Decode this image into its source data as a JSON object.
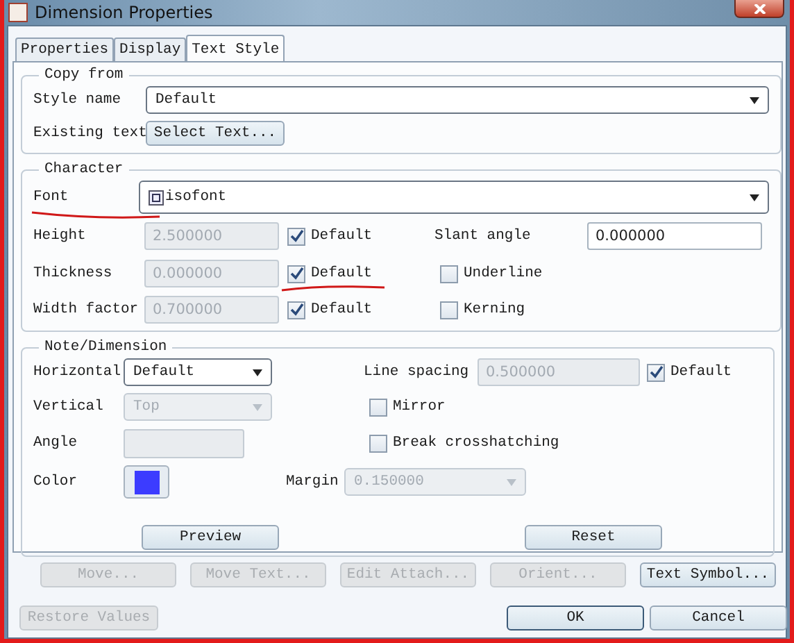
{
  "window": {
    "title": "Dimension Properties"
  },
  "tabs": [
    {
      "label": "Properties",
      "selected": false
    },
    {
      "label": "Display",
      "selected": false
    },
    {
      "label": "Text Style",
      "selected": true
    }
  ],
  "copy_from": {
    "title": "Copy from",
    "style_name": {
      "label": "Style name",
      "value": "Default"
    },
    "existing_text": {
      "label": "Existing text",
      "button": "Select Text..."
    }
  },
  "character": {
    "title": "Character",
    "font": {
      "label": "Font",
      "value": "isofont"
    },
    "rows": [
      {
        "label": "Height",
        "value": "2.500000",
        "disabled": true,
        "default_label": "Default",
        "default_checked": true,
        "side": {
          "kind": "field",
          "label": "Slant angle",
          "value": "0.000000"
        }
      },
      {
        "label": "Thickness",
        "value": "0.000000",
        "disabled": true,
        "default_label": "Default",
        "default_checked": true,
        "side": {
          "kind": "checkbox",
          "label": "Underline",
          "checked": false
        }
      },
      {
        "label": "Width factor",
        "value": "0.700000",
        "disabled": true,
        "default_label": "Default",
        "default_checked": true,
        "side": {
          "kind": "checkbox",
          "label": "Kerning",
          "checked": false
        }
      }
    ]
  },
  "note": {
    "title": "Note/Dimension",
    "horizontal": {
      "label": "Horizontal",
      "value": "Default",
      "disabled": false
    },
    "vertical": {
      "label": "Vertical",
      "value": "Top",
      "disabled": true
    },
    "angle": {
      "label": "Angle",
      "disabled": true
    },
    "color": {
      "label": "Color",
      "color": "#3c3cff"
    },
    "line_spacing": {
      "label": "Line spacing",
      "value": "0.500000",
      "disabled": true,
      "default_label": "Default",
      "default_checked": true
    },
    "mirror": {
      "label": "Mirror",
      "checked": false
    },
    "break_crosshatching": {
      "label": "Break crosshatching",
      "checked": false
    },
    "margin": {
      "label": "Margin",
      "value": "0.150000",
      "disabled": true
    },
    "preview": "Preview",
    "reset": "Reset"
  },
  "actions": [
    {
      "label": "Move...",
      "disabled": true
    },
    {
      "label": "Move Text...",
      "disabled": true
    },
    {
      "label": "Edit Attach...",
      "disabled": true
    },
    {
      "label": "Orient...",
      "disabled": true
    },
    {
      "label": "Text Symbol...",
      "disabled": false
    }
  ],
  "footer": {
    "restore": {
      "label": "Restore Values",
      "disabled": true
    },
    "ok": {
      "label": "OK",
      "disabled": false
    },
    "cancel": {
      "label": "Cancel",
      "disabled": false
    }
  }
}
